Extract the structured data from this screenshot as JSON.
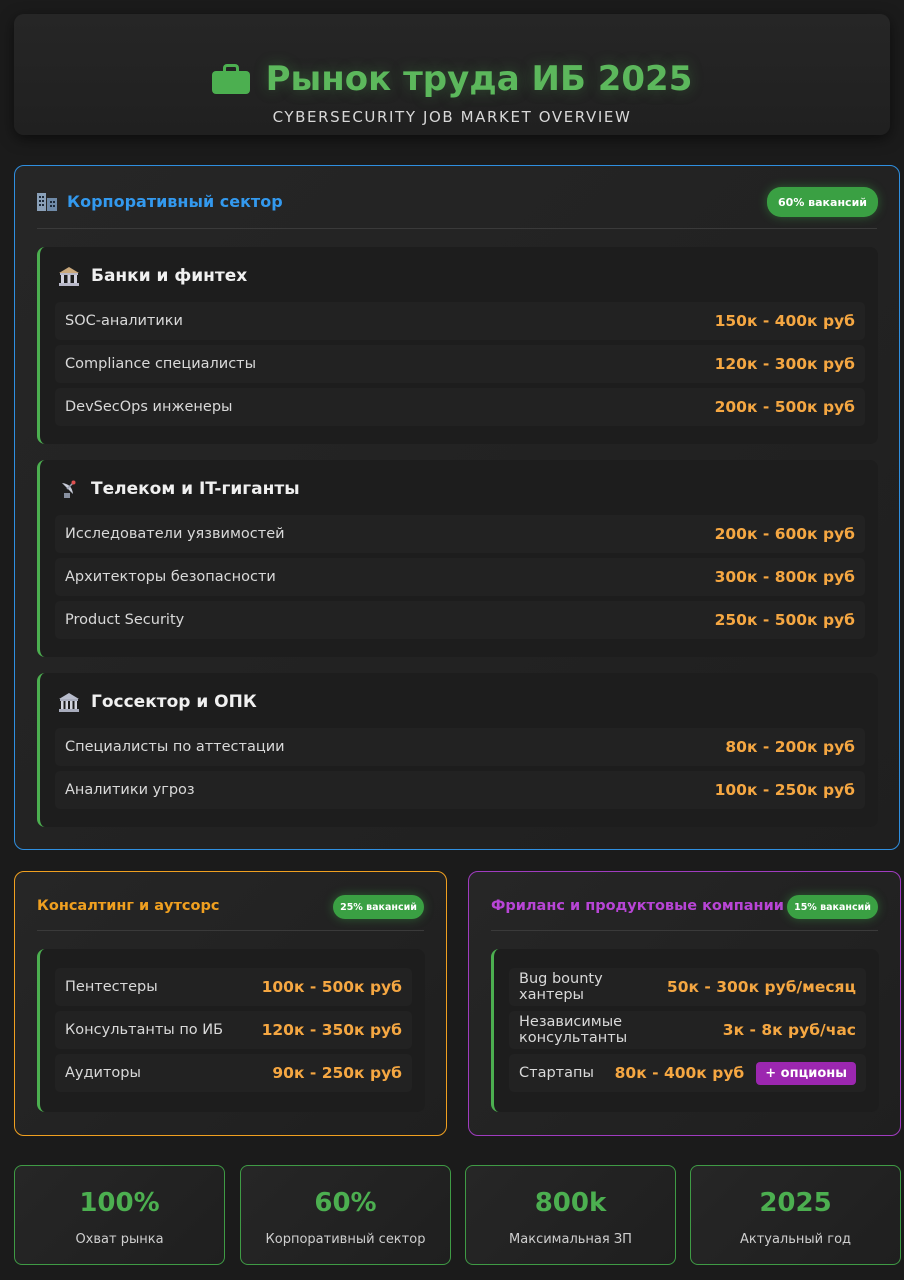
{
  "header": {
    "title": "Рынок труда ИБ 2025",
    "subtitle": "CYBERSECURITY JOB MARKET OVERVIEW",
    "icon": "briefcase-icon"
  },
  "colors": {
    "accent_green": "#4caf50",
    "salary_orange": "#f5a742",
    "corporate_blue": "#2f8fe0",
    "consulting_orange": "#f0a020",
    "freelance_purple": "#a03cc0"
  },
  "corporate": {
    "title": "Корпоративный сектор",
    "badge": "60% вакансий",
    "icon": "office-building-icon",
    "groups": [
      {
        "title": "Банки и финтех",
        "icon": "bank-icon",
        "rows": [
          {
            "role": "SOC-аналитики",
            "salary": "150к - 400к руб"
          },
          {
            "role": "Compliance специалисты",
            "salary": "120к - 300к руб"
          },
          {
            "role": "DevSecOps инженеры",
            "salary": "200к - 500к руб"
          }
        ]
      },
      {
        "title": "Телеком и IT-гиганты",
        "icon": "satellite-dish-icon",
        "rows": [
          {
            "role": "Исследователи уязвимостей",
            "salary": "200к - 600к руб"
          },
          {
            "role": "Архитекторы безопасности",
            "salary": "300к - 800к руб"
          },
          {
            "role": "Product Security",
            "salary": "250к - 500к руб"
          }
        ]
      },
      {
        "title": "Госсектор и ОПК",
        "icon": "government-building-icon",
        "rows": [
          {
            "role": "Специалисты по аттестации",
            "salary": "80к - 200к руб"
          },
          {
            "role": "Аналитики угроз",
            "salary": "100к - 250к руб"
          }
        ]
      }
    ]
  },
  "consulting": {
    "title": "Консалтинг и аутсорс",
    "badge": "25% вакансий",
    "rows": [
      {
        "role": "Пентестеры",
        "salary": "100к - 500к руб"
      },
      {
        "role": "Консультанты по ИБ",
        "salary": "120к - 350к руб"
      },
      {
        "role": "Аудиторы",
        "salary": "90к - 250к руб"
      }
    ]
  },
  "freelance": {
    "title": "Фриланс и продуктовые компании",
    "badge": "15% вакансий",
    "rows": [
      {
        "role": "Bug bounty хантеры",
        "salary": "50к - 300к руб/месяц"
      },
      {
        "role": "Независимые консультанты",
        "salary": "3к - 8к руб/час"
      },
      {
        "role": "Стартапы",
        "salary": "80к - 400к руб",
        "extra": "+ опционы"
      }
    ]
  },
  "stats": [
    {
      "value": "100%",
      "label": "Охват рынка"
    },
    {
      "value": "60%",
      "label": "Корпоративный сектор"
    },
    {
      "value": "800k",
      "label": "Максимальная ЗП"
    },
    {
      "value": "2025",
      "label": "Актуальный год"
    }
  ]
}
